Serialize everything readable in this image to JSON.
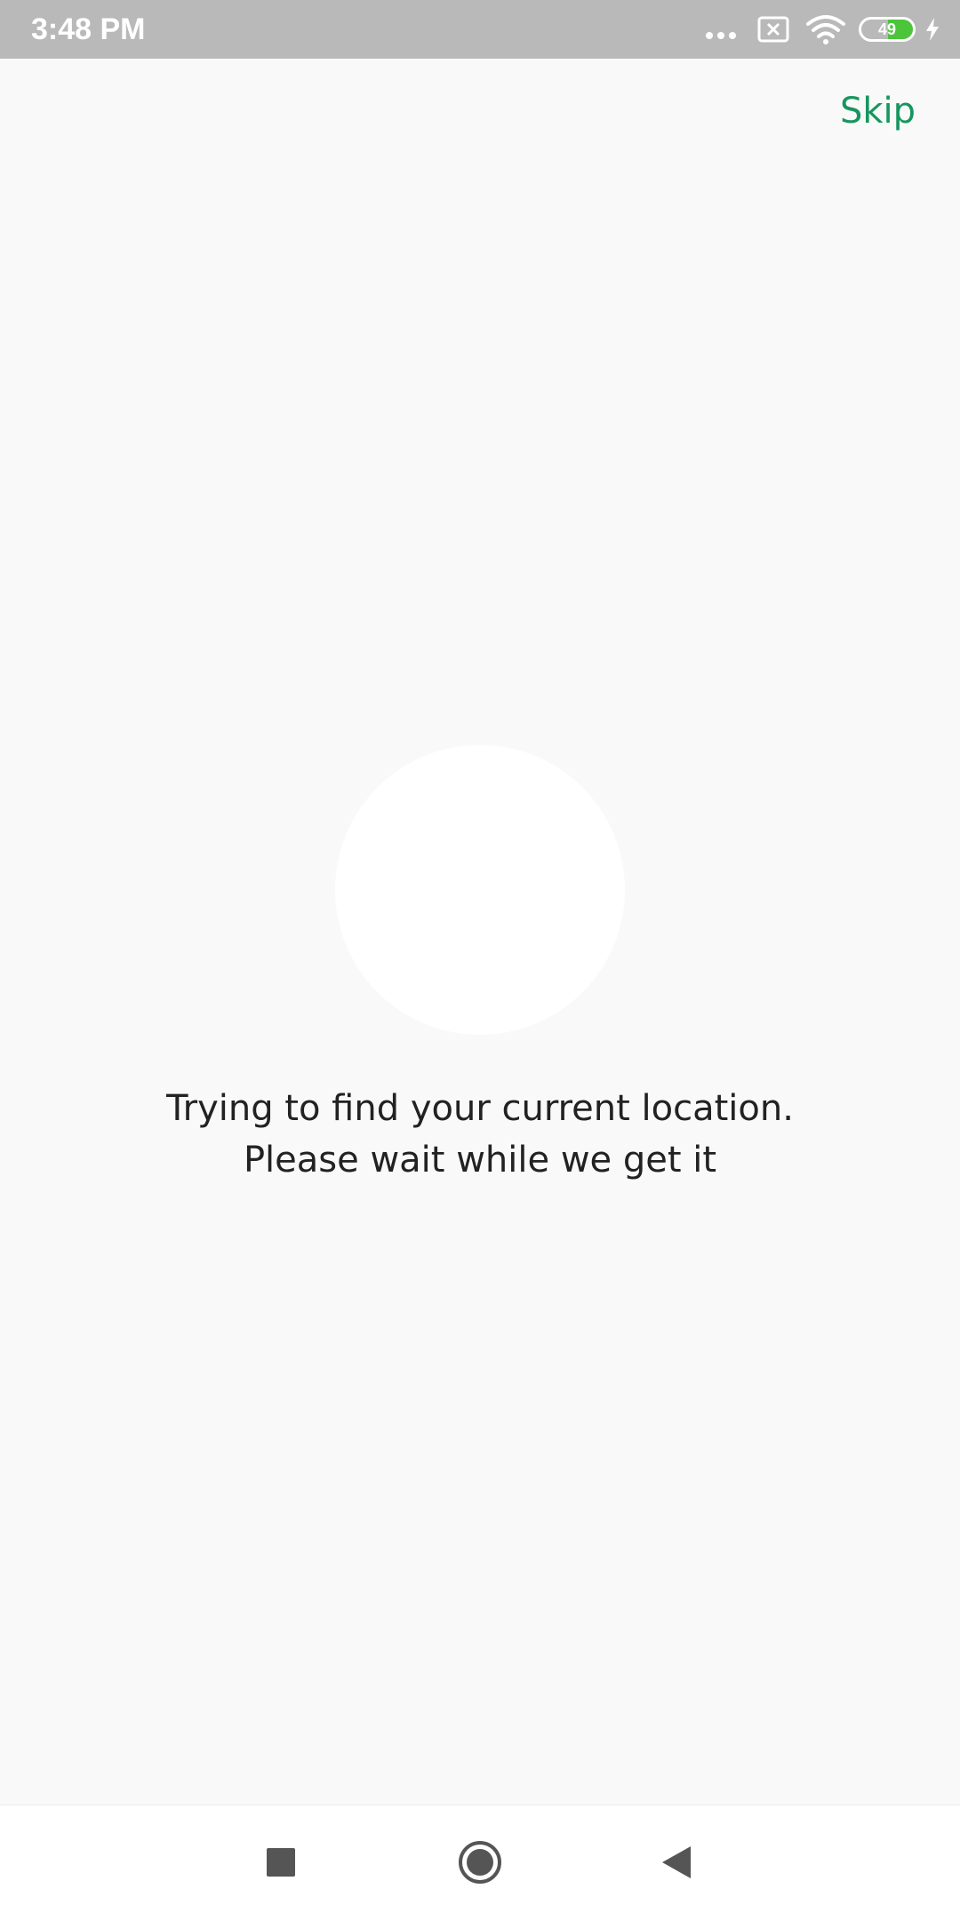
{
  "status_bar": {
    "time": "3:48 PM",
    "battery_level": "49",
    "icons": [
      "more-dots-icon",
      "sim-missing-icon",
      "wifi-icon",
      "battery-icon",
      "charging-icon"
    ]
  },
  "header": {
    "skip_label": "Skip"
  },
  "main": {
    "message_line1": "Trying to find your current location.",
    "message_line2": "Please wait while we get it"
  },
  "nav_bar": {
    "icons": [
      "recent-apps-icon",
      "home-icon",
      "back-icon"
    ]
  },
  "colors": {
    "accent": "#16965e",
    "background": "#f9f9f9",
    "status_bar": "#b9b9b9",
    "battery": "#4cc53b"
  }
}
